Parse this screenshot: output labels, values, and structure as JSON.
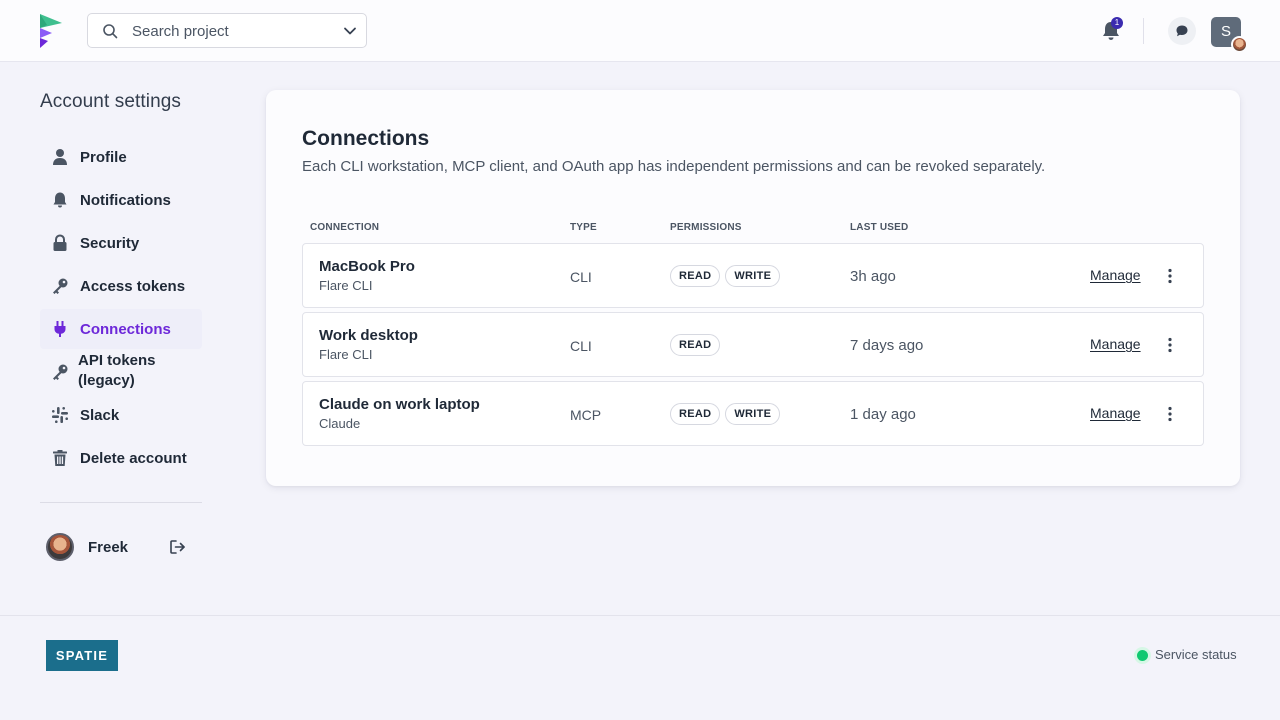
{
  "topbar": {
    "search_placeholder": "Search project",
    "notification_count": "1",
    "user_initial": "S"
  },
  "sidebar": {
    "title": "Account settings",
    "items": [
      {
        "label": "Profile",
        "icon": "user-icon"
      },
      {
        "label": "Notifications",
        "icon": "bell-icon"
      },
      {
        "label": "Security",
        "icon": "lock-icon"
      },
      {
        "label": "Access tokens",
        "icon": "key-icon"
      },
      {
        "label": "Connections",
        "icon": "plug-icon",
        "active": true
      },
      {
        "label": "API tokens (legacy)",
        "icon": "key-icon"
      },
      {
        "label": "Slack",
        "icon": "slack-icon"
      },
      {
        "label": "Delete account",
        "icon": "trash-icon"
      }
    ],
    "user_name": "Freek"
  },
  "main": {
    "title": "Connections",
    "description": "Each CLI workstation, MCP client, and OAuth app has independent permissions and can be revoked separately.",
    "columns": [
      "Connection",
      "Type",
      "Permissions",
      "Last used"
    ],
    "rows": [
      {
        "name": "MacBook Pro",
        "client": "Flare CLI",
        "type": "CLI",
        "permissions": [
          "READ",
          "WRITE"
        ],
        "last_used": "3h ago",
        "action": "Manage"
      },
      {
        "name": "Work desktop",
        "client": "Flare CLI",
        "type": "CLI",
        "permissions": [
          "READ"
        ],
        "last_used": "7 days ago",
        "action": "Manage"
      },
      {
        "name": "Claude on work laptop",
        "client": "Claude",
        "type": "MCP",
        "permissions": [
          "READ",
          "WRITE"
        ],
        "last_used": "1 day ago",
        "action": "Manage"
      }
    ]
  },
  "footer": {
    "brand": "SPATIE",
    "status_label": "Service status",
    "status_color": "#10c971"
  },
  "colors": {
    "accent": "#6d28d9",
    "brand": "#1b6e8c"
  }
}
